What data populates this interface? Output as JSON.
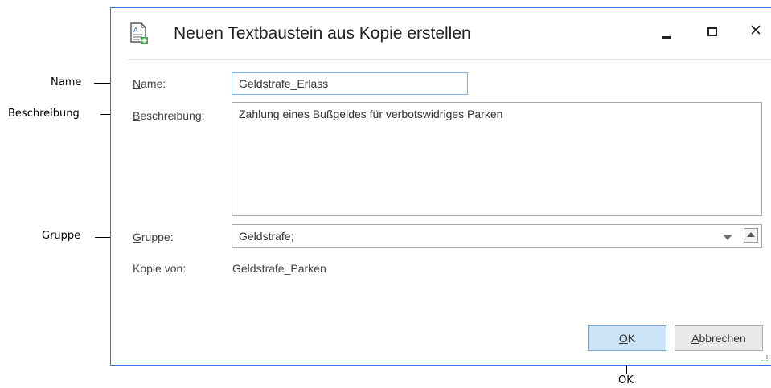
{
  "callouts": {
    "name": "Name",
    "beschreibung": "Beschreibung",
    "gruppe": "Gruppe",
    "ok": "OK"
  },
  "dialog": {
    "title": "Neuen Textbaustein aus Kopie erstellen",
    "icon": "document-add-icon",
    "window_buttons": [
      "minimize-icon",
      "maximize-icon",
      "close-icon"
    ],
    "close_glyph": "✕"
  },
  "form": {
    "name": {
      "label_mnemonic": "N",
      "label_rest": "ame:",
      "value": "Geldstrafe_Erlass"
    },
    "beschreibung": {
      "label_mnemonic": "B",
      "label_rest": "eschreibung:",
      "value": "Zahlung eines Bußgeldes für verbotswidriges Parken"
    },
    "gruppe": {
      "label_mnemonic": "G",
      "label_rest": "ruppe:",
      "value": "Geldstrafe;"
    },
    "kopie_von": {
      "label": "Kopie von:",
      "value": "Geldstrafe_Parken"
    }
  },
  "buttons": {
    "ok": {
      "mnemonic": "O",
      "rest": "K"
    },
    "cancel": {
      "mnemonic": "A",
      "rest": "bbrechen"
    }
  },
  "colors": {
    "window_border": "#2b79d6",
    "ok_button": "#cce4f7",
    "focus_border": "#7eb4ea"
  }
}
